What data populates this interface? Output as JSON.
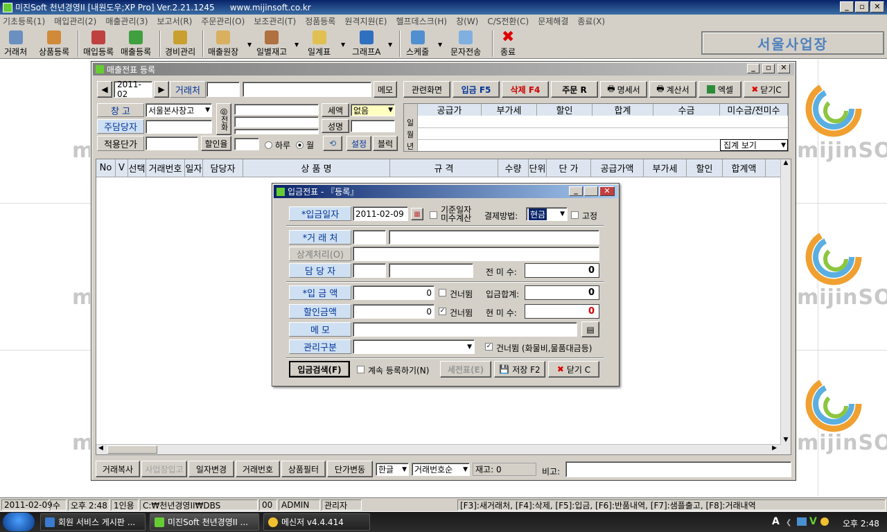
{
  "app": {
    "title": "미진Soft 천년경영II [내원도우;XP Pro] Ver.2.21.1245",
    "url": "www.mijinsoft.co.kr"
  },
  "window_buttons": {
    "min": "_",
    "max": "▫",
    "close": "✕"
  },
  "menu": [
    "기초등록(1)",
    "매입관리(2)",
    "매출관리(3)",
    "보고서(R)",
    "주문관리(O)",
    "보조관리(T)",
    "정품등록",
    "원격지원(E)",
    "헬프데스크(H)",
    "창(W)",
    "C/S전환(C)",
    "문제해결",
    "종료(X)"
  ],
  "toolbar": {
    "items": [
      "거래처",
      "상품등록",
      "매입등록",
      "매출등록",
      "경비관리",
      "매출원장",
      "일별재고",
      "일계표",
      "그래프A",
      "스케줄",
      "문자전송",
      "종료"
    ],
    "branch": "서울사업장"
  },
  "logo_text": "mijinSOFT",
  "sales": {
    "title": "매출전표 등록",
    "date": "2011-02",
    "prev": "◀",
    "next": "▶",
    "client_label": "거래처",
    "memo_btn": "메모",
    "actions": [
      "관련화면",
      "입금 F5",
      "삭제 F4",
      "주문 R",
      "명세서",
      "계산서",
      "엑셀",
      "닫기C"
    ],
    "warehouse_label": "창    고",
    "warehouse_value": "서울본사창고",
    "manager_label": "주담당자",
    "unitprice_label": "적용단가",
    "discount_btn": "할인율",
    "phone_btn": "@전화",
    "tax_btn": "세액",
    "tax_value": "없음",
    "desc_btn": "성명",
    "radio_day": "하루",
    "radio_month": "월",
    "settings_btn": "설정",
    "block_btn": "블럭",
    "summary_headers": [
      "공급가",
      "부가세",
      "할인",
      "합계",
      "수금",
      "미수금/전미수"
    ],
    "summary_rows": [
      "일",
      "월",
      "년"
    ],
    "summary_select": "집계 보기",
    "grid_headers": [
      "No",
      "V",
      "선택",
      "거래번호",
      "일자",
      "담당자",
      "상 품 명",
      "규 격",
      "수량",
      "단위",
      "단 가",
      "공급가액",
      "부가세",
      "할인",
      "합계액"
    ],
    "bottom": [
      "거래복사",
      "사업장입고",
      "일자변경",
      "거래번호",
      "상품필터",
      "단가변동"
    ],
    "lang": "한글",
    "sort": "거래번호순",
    "stock": "재고: 0",
    "note_label": "비고:"
  },
  "dialog": {
    "title": "입금전표 - 『등록』",
    "date_label": "*입금일자",
    "date": "2011-02-09",
    "basis_check": "기준일자 미수계산",
    "pay_label": "결제방법:",
    "pay_value": "현금",
    "fix_check": "고정",
    "client_label": "*거 래 처",
    "offset_label": "상계처리(O)",
    "manager_label": "담 당 자",
    "prev_unpaid_label": "전 미 수:",
    "prev_unpaid": "0",
    "amount_label": "*입 금 액",
    "amount": "0",
    "skip1": "건너뜀",
    "sum_label": "입금합계:",
    "sum": "0",
    "disc_label": "할인금액",
    "disc": "0",
    "skip2": "건너뜀",
    "cur_unpaid_label": "현 미 수:",
    "cur_unpaid": "0",
    "memo_label": "메    모",
    "mgmt_label": "관리구분",
    "skip3": "건너뜀 (화물비,물품대금등)",
    "search_btn": "입금검색(F)",
    "continue_check": "계속 등록하기(N)",
    "tax_btn": "세전표(E)",
    "save_btn": "저장 F2",
    "close_btn": "닫기 C"
  },
  "status": {
    "date": "2011-02-09",
    "day": "수",
    "time": "오후 2:48",
    "mode": "1인용",
    "path": "C:₩천년경영II₩DBS",
    "code": "00",
    "user": "ADMIN",
    "role": "관리자",
    "keys": "[F3]:새거래처, [F4]:삭제, [F5]:입금, [F6]:반품내역, [F7]:샘플출고, [F8]:거래내역"
  },
  "taskbar": {
    "tasks": [
      "회원 서비스 게시판 ...",
      "미진Soft 천년경영II ...",
      "메신저 v4.4.414"
    ],
    "clock": "오후 2:48"
  },
  "colors": {
    "title_active": "#0a246a",
    "face": "#d4d0c8",
    "label_blue": "#cfe0f2",
    "red": "#cc0000"
  }
}
